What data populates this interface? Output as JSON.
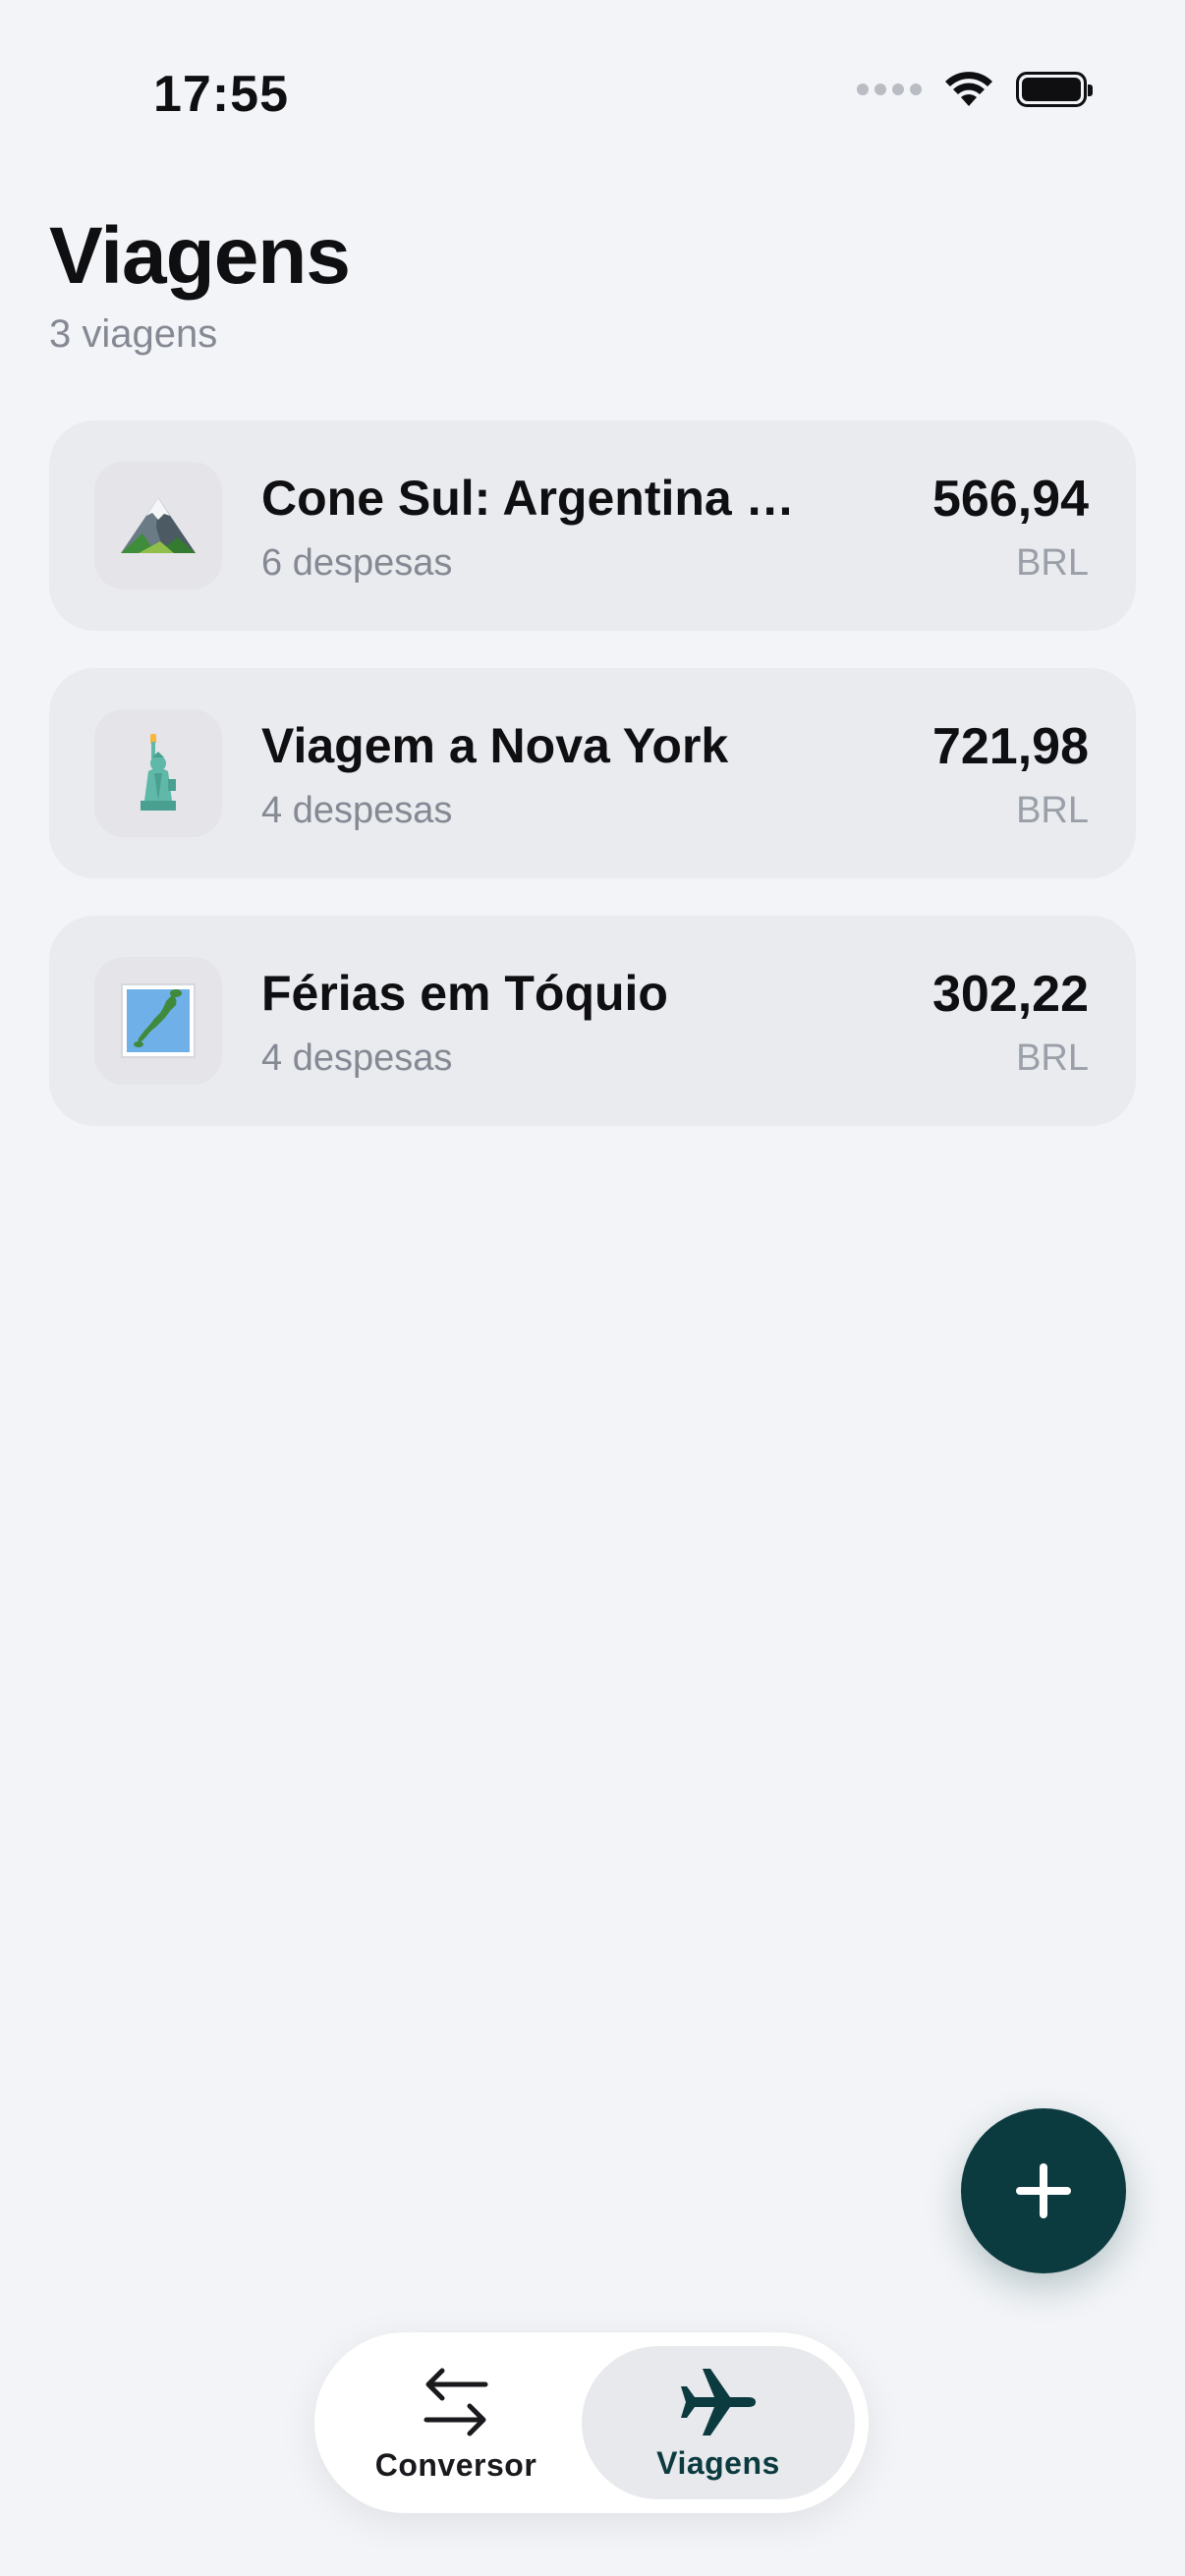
{
  "status_bar": {
    "time": "17:55"
  },
  "header": {
    "title": "Viagens",
    "subtitle": "3 viagens"
  },
  "trips": [
    {
      "icon": "mountain-icon",
      "name": "Cone Sul: Argentina e...",
      "expenses": "6 despesas",
      "amount": "566,94",
      "currency": "BRL"
    },
    {
      "icon": "statue-of-liberty-icon",
      "name": "Viagem a Nova York",
      "expenses": "4 despesas",
      "amount": "721,98",
      "currency": "BRL"
    },
    {
      "icon": "japan-map-icon",
      "name": "Férias em Tóquio",
      "expenses": "4 despesas",
      "amount": "302,22",
      "currency": "BRL"
    }
  ],
  "fab": {
    "icon": "plus-icon"
  },
  "tab_bar": {
    "tabs": [
      {
        "label": "Conversor",
        "icon": "swap-arrows-icon",
        "selected": false
      },
      {
        "label": "Viagens",
        "icon": "airplane-icon",
        "selected": true
      }
    ]
  },
  "colors": {
    "background": "#f2f4f7",
    "card": "#e9ebef",
    "accent": "#0b3a3f",
    "secondary_text": "#858993"
  }
}
